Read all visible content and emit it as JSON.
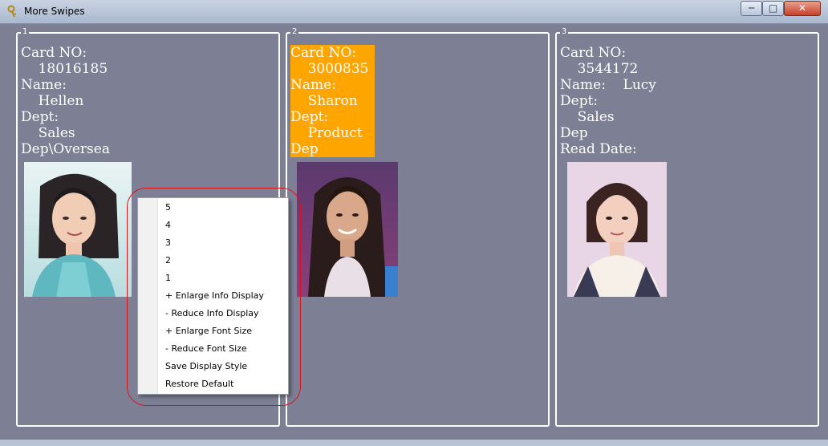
{
  "window": {
    "title": "More Swipes",
    "min_label": "─",
    "max_label": "□",
    "close_label": "✕"
  },
  "panels": [
    {
      "number": "1",
      "info_text": "Card NO:\n    18016185\nName:\n    Hellen\nDept:\n    Sales\nDep\\Oversea",
      "highlighted": false
    },
    {
      "number": "2",
      "info_text": "Card NO:\n    3000835\nName:\n    Sharon\nDept:\n    Product\nDep",
      "highlighted": true
    },
    {
      "number": "3",
      "info_text": "Card NO:\n    3544172\nName:    Lucy\nDept:\n    Sales\nDep\nRead Date:",
      "highlighted": false
    }
  ],
  "context_menu": {
    "items": [
      "5",
      "4",
      "3",
      "2",
      "1",
      "+ Enlarge Info Display",
      "- Reduce Info Display",
      "+ Enlarge Font Size",
      "- Reduce Font Size",
      "Save Display Style",
      "Restore Default"
    ]
  },
  "colors": {
    "background": "#7d8095",
    "highlight": "#ffa500",
    "ring": "#e0101a"
  }
}
